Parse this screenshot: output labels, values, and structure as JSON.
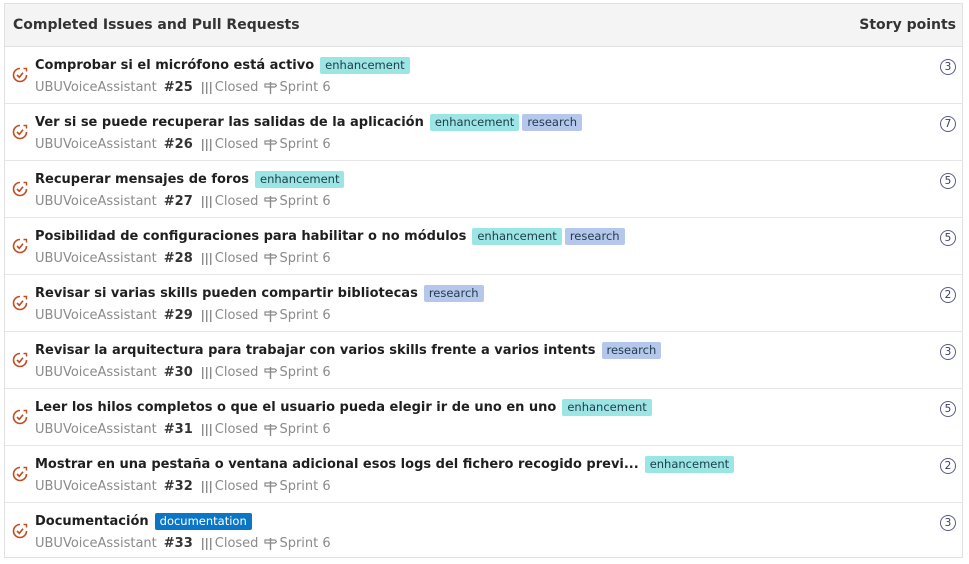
{
  "header": {
    "title": "Completed Issues and Pull Requests",
    "points_label": "Story points"
  },
  "colors": {
    "enhancement": "#9be5e5",
    "research": "#b6c7ec",
    "documentation": "#0b76c6",
    "closed_icon": "#c44a1f"
  },
  "items": [
    {
      "title": "Comprobar si el micrófono está activo",
      "labels": [
        "enhancement"
      ],
      "repo": "UBUVoiceAssistant",
      "number": "#25",
      "state": "Closed",
      "sprint": "Sprint 6",
      "points": "3"
    },
    {
      "title": "Ver si se puede recuperar las salidas de la aplicación",
      "labels": [
        "enhancement",
        "research"
      ],
      "repo": "UBUVoiceAssistant",
      "number": "#26",
      "state": "Closed",
      "sprint": "Sprint 6",
      "points": "7"
    },
    {
      "title": "Recuperar mensajes de foros",
      "labels": [
        "enhancement"
      ],
      "repo": "UBUVoiceAssistant",
      "number": "#27",
      "state": "Closed",
      "sprint": "Sprint 6",
      "points": "5"
    },
    {
      "title": "Posibilidad de configuraciones para habilitar o no módulos",
      "labels": [
        "enhancement",
        "research"
      ],
      "repo": "UBUVoiceAssistant",
      "number": "#28",
      "state": "Closed",
      "sprint": "Sprint 6",
      "points": "5"
    },
    {
      "title": "Revisar si varias skills pueden compartir bibliotecas",
      "labels": [
        "research"
      ],
      "repo": "UBUVoiceAssistant",
      "number": "#29",
      "state": "Closed",
      "sprint": "Sprint 6",
      "points": "2"
    },
    {
      "title": "Revisar la arquitectura para trabajar con varios skills frente a varios intents",
      "labels": [
        "research"
      ],
      "repo": "UBUVoiceAssistant",
      "number": "#30",
      "state": "Closed",
      "sprint": "Sprint 6",
      "points": "3"
    },
    {
      "title": "Leer los hilos completos o que el usuario pueda elegir ir de uno en uno",
      "labels": [
        "enhancement"
      ],
      "repo": "UBUVoiceAssistant",
      "number": "#31",
      "state": "Closed",
      "sprint": "Sprint 6",
      "points": "5"
    },
    {
      "title": "Mostrar en una pestaña o ventana adicional esos logs del fichero recogido previ...",
      "labels": [
        "enhancement"
      ],
      "repo": "UBUVoiceAssistant",
      "number": "#32",
      "state": "Closed",
      "sprint": "Sprint 6",
      "points": "2"
    },
    {
      "title": "Documentación",
      "labels": [
        "documentation"
      ],
      "repo": "UBUVoiceAssistant",
      "number": "#33",
      "state": "Closed",
      "sprint": "Sprint 6",
      "points": "3"
    }
  ]
}
